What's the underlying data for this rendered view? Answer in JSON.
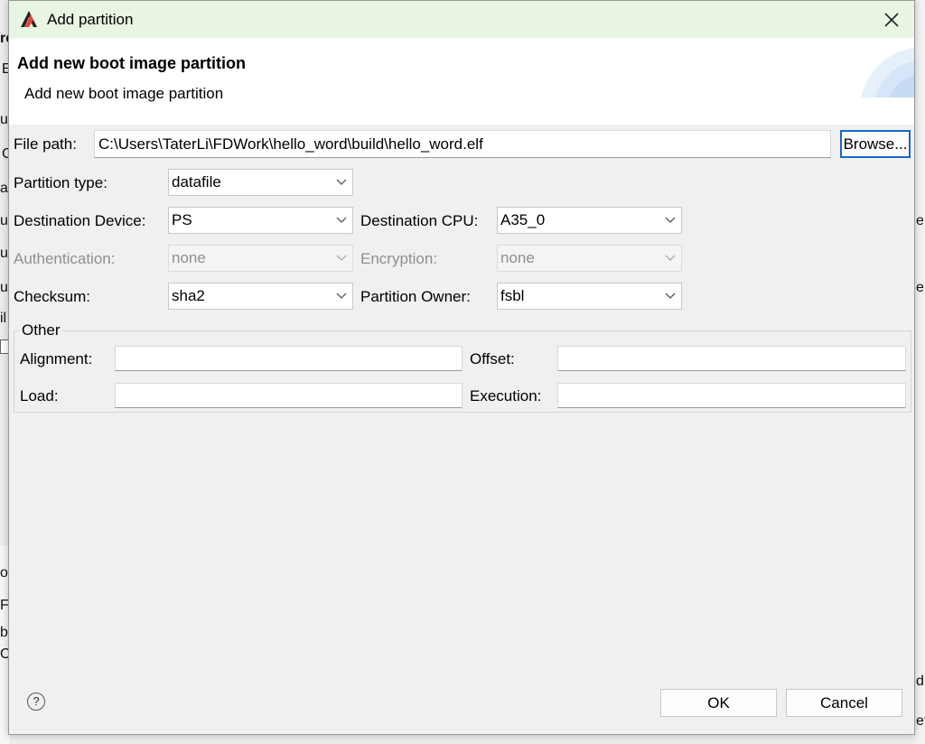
{
  "window": {
    "title": "Add partition"
  },
  "banner": {
    "title": "Add new boot image partition",
    "description": "Add new boot image partition"
  },
  "file_path": {
    "label": "File path:",
    "value": "C:\\Users\\TaterLi\\FDWork\\hello_word\\build\\hello_word.elf",
    "browse_label": "Browse..."
  },
  "partition_type": {
    "label": "Partition type:",
    "value": "datafile"
  },
  "destination_device": {
    "label": "Destination Device:",
    "value": "PS"
  },
  "destination_cpu": {
    "label": "Destination CPU:",
    "value": "A35_0"
  },
  "authentication": {
    "label": "Authentication:",
    "value": "none"
  },
  "encryption": {
    "label": "Encryption:",
    "value": "none"
  },
  "checksum": {
    "label": "Checksum:",
    "value": "sha2"
  },
  "partition_owner": {
    "label": "Partition Owner:",
    "value": "fsbl"
  },
  "other": {
    "title": "Other",
    "alignment_label": "Alignment:",
    "alignment_value": "",
    "offset_label": "Offset:",
    "offset_value": "",
    "load_label": "Load:",
    "load_value": "",
    "execution_label": "Execution:",
    "execution_value": ""
  },
  "footer": {
    "help_glyph": "?",
    "ok_label": "OK",
    "cancel_label": "Cancel"
  },
  "background_fragments": [
    "re",
    "E",
    "ui",
    "C",
    "a",
    "u",
    "u",
    "u",
    "il",
    "o",
    "Fil",
    "b",
    "O:",
    "e.",
    "e.",
    "d",
    "et"
  ],
  "colors": {
    "titlebar": "#e8f5e2",
    "accent": "#1a66c8",
    "dialog_bg": "#f0f0f0"
  }
}
